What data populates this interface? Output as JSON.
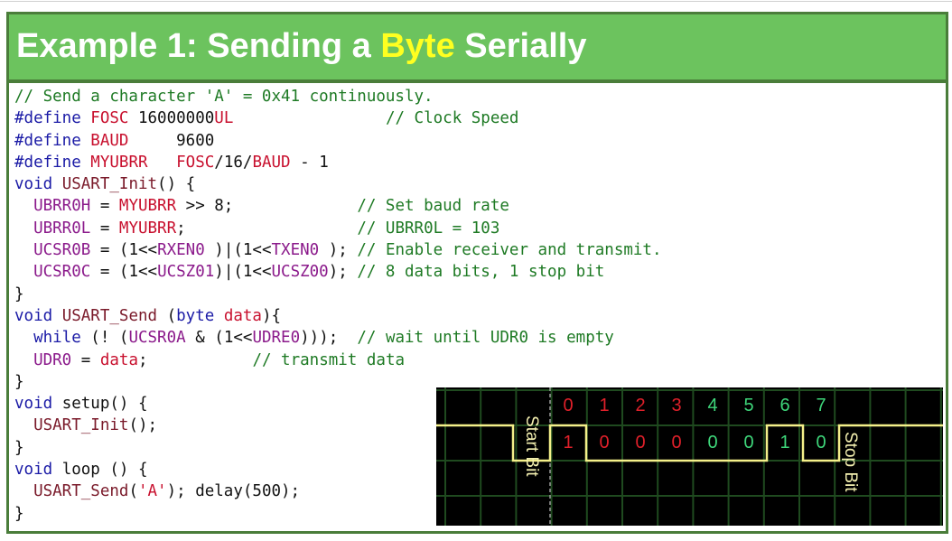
{
  "slide": {
    "title_before": "Example 1: Sending a ",
    "title_highlight": "Byte",
    "title_after": " Serially"
  },
  "code": {
    "lines": [
      [
        {
          "t": "// Send a character 'A' = 0x41 continuously.",
          "c": "cm"
        }
      ],
      [
        {
          "t": "#define ",
          "c": "kw"
        },
        {
          "t": "FOSC",
          "c": "mac"
        },
        {
          "t": " 16000000",
          "c": "pl"
        },
        {
          "t": "UL",
          "c": "mac"
        },
        {
          "t": "                ",
          "c": "pl"
        },
        {
          "t": "// Clock Speed",
          "c": "cm"
        }
      ],
      [
        {
          "t": "#define ",
          "c": "kw"
        },
        {
          "t": "BAUD",
          "c": "mac"
        },
        {
          "t": "     9600",
          "c": "pl"
        }
      ],
      [
        {
          "t": "#define ",
          "c": "kw"
        },
        {
          "t": "MYUBRR",
          "c": "mac"
        },
        {
          "t": "   ",
          "c": "pl"
        },
        {
          "t": "FOSC",
          "c": "mac"
        },
        {
          "t": "/16/",
          "c": "pl"
        },
        {
          "t": "BAUD",
          "c": "mac"
        },
        {
          "t": " - 1",
          "c": "pl"
        }
      ],
      [
        {
          "t": "void ",
          "c": "kw"
        },
        {
          "t": "USART_Init",
          "c": "fn"
        },
        {
          "t": "() {",
          "c": "pl"
        }
      ],
      [
        {
          "t": "  ",
          "c": "pl"
        },
        {
          "t": "UBRR0H",
          "c": "reg"
        },
        {
          "t": " = ",
          "c": "pl"
        },
        {
          "t": "MYUBRR",
          "c": "mac"
        },
        {
          "t": " >> 8;             ",
          "c": "pl"
        },
        {
          "t": "// Set baud rate",
          "c": "cm"
        }
      ],
      [
        {
          "t": "  ",
          "c": "pl"
        },
        {
          "t": "UBRR0L",
          "c": "reg"
        },
        {
          "t": " = ",
          "c": "pl"
        },
        {
          "t": "MYUBRR",
          "c": "mac"
        },
        {
          "t": ";                  ",
          "c": "pl"
        },
        {
          "t": "// UBRR0L = 103",
          "c": "cm"
        }
      ],
      [
        {
          "t": "  ",
          "c": "pl"
        },
        {
          "t": "UCSR0B",
          "c": "reg"
        },
        {
          "t": " = (1<<",
          "c": "pl"
        },
        {
          "t": "RXEN0",
          "c": "reg"
        },
        {
          "t": " )|(1<<",
          "c": "pl"
        },
        {
          "t": "TXEN0",
          "c": "reg"
        },
        {
          "t": " ); ",
          "c": "pl"
        },
        {
          "t": "// Enable receiver and transmit.",
          "c": "cm"
        }
      ],
      [
        {
          "t": "  ",
          "c": "pl"
        },
        {
          "t": "UCSR0C",
          "c": "reg"
        },
        {
          "t": " = (1<<",
          "c": "pl"
        },
        {
          "t": "UCSZ01",
          "c": "reg"
        },
        {
          "t": ")|(1<<",
          "c": "pl"
        },
        {
          "t": "UCSZ00",
          "c": "reg"
        },
        {
          "t": "); ",
          "c": "pl"
        },
        {
          "t": "// 8 data bits, 1 stop bit",
          "c": "cm"
        }
      ],
      [
        {
          "t": "}",
          "c": "pl"
        }
      ],
      [
        {
          "t": "void ",
          "c": "kw"
        },
        {
          "t": "USART_Send",
          "c": "fn"
        },
        {
          "t": " (",
          "c": "pl"
        },
        {
          "t": "byte",
          "c": "kw"
        },
        {
          "t": " ",
          "c": "pl"
        },
        {
          "t": "data",
          "c": "mac"
        },
        {
          "t": "){",
          "c": "pl"
        }
      ],
      [
        {
          "t": "  ",
          "c": "pl"
        },
        {
          "t": "while",
          "c": "kw"
        },
        {
          "t": " (! (",
          "c": "pl"
        },
        {
          "t": "UCSR0A",
          "c": "reg"
        },
        {
          "t": " & (1<<",
          "c": "pl"
        },
        {
          "t": "UDRE0",
          "c": "reg"
        },
        {
          "t": ")));  ",
          "c": "pl"
        },
        {
          "t": "// wait until UDR0 is empty",
          "c": "cm"
        }
      ],
      [
        {
          "t": "  ",
          "c": "pl"
        },
        {
          "t": "UDR0",
          "c": "reg"
        },
        {
          "t": " = ",
          "c": "pl"
        },
        {
          "t": "data",
          "c": "mac"
        },
        {
          "t": ";           ",
          "c": "pl"
        },
        {
          "t": "// transmit data",
          "c": "cm"
        }
      ],
      [
        {
          "t": "}",
          "c": "pl"
        }
      ],
      [
        {
          "t": "void ",
          "c": "kw"
        },
        {
          "t": "setup",
          "c": "pl"
        },
        {
          "t": "() {",
          "c": "pl"
        }
      ],
      [
        {
          "t": "  ",
          "c": "pl"
        },
        {
          "t": "USART_Init",
          "c": "fn"
        },
        {
          "t": "();",
          "c": "pl"
        }
      ],
      [
        {
          "t": "}",
          "c": "pl"
        }
      ],
      [
        {
          "t": "void ",
          "c": "kw"
        },
        {
          "t": "loop",
          "c": "pl"
        },
        {
          "t": " () {",
          "c": "pl"
        }
      ],
      [
        {
          "t": "  ",
          "c": "pl"
        },
        {
          "t": "USART_Send",
          "c": "fn"
        },
        {
          "t": "(",
          "c": "pl"
        },
        {
          "t": "'A'",
          "c": "mac"
        },
        {
          "t": "); delay(500);",
          "c": "pl"
        }
      ],
      [
        {
          "t": "}",
          "c": "pl"
        }
      ]
    ]
  },
  "waveform": {
    "bit_indices": [
      "0",
      "1",
      "2",
      "3",
      "4",
      "5",
      "6",
      "7"
    ],
    "bit_values": [
      "1",
      "0",
      "0",
      "0",
      "0",
      "0",
      "1",
      "0"
    ],
    "start_label": "Start Bit",
    "stop_label": "Stop Bit",
    "levels_sequence": [
      "idle-high",
      "start-low",
      "d0",
      "d1",
      "d2",
      "d3",
      "d4",
      "d5",
      "d6",
      "d7",
      "stop-high"
    ],
    "colors": {
      "background": "#000000",
      "grid": "#1f4a1f",
      "signal": "#f4f08a",
      "label_red": "#e0202a",
      "label_green": "#3ed67a",
      "annotation": "#f4f0b0"
    }
  }
}
